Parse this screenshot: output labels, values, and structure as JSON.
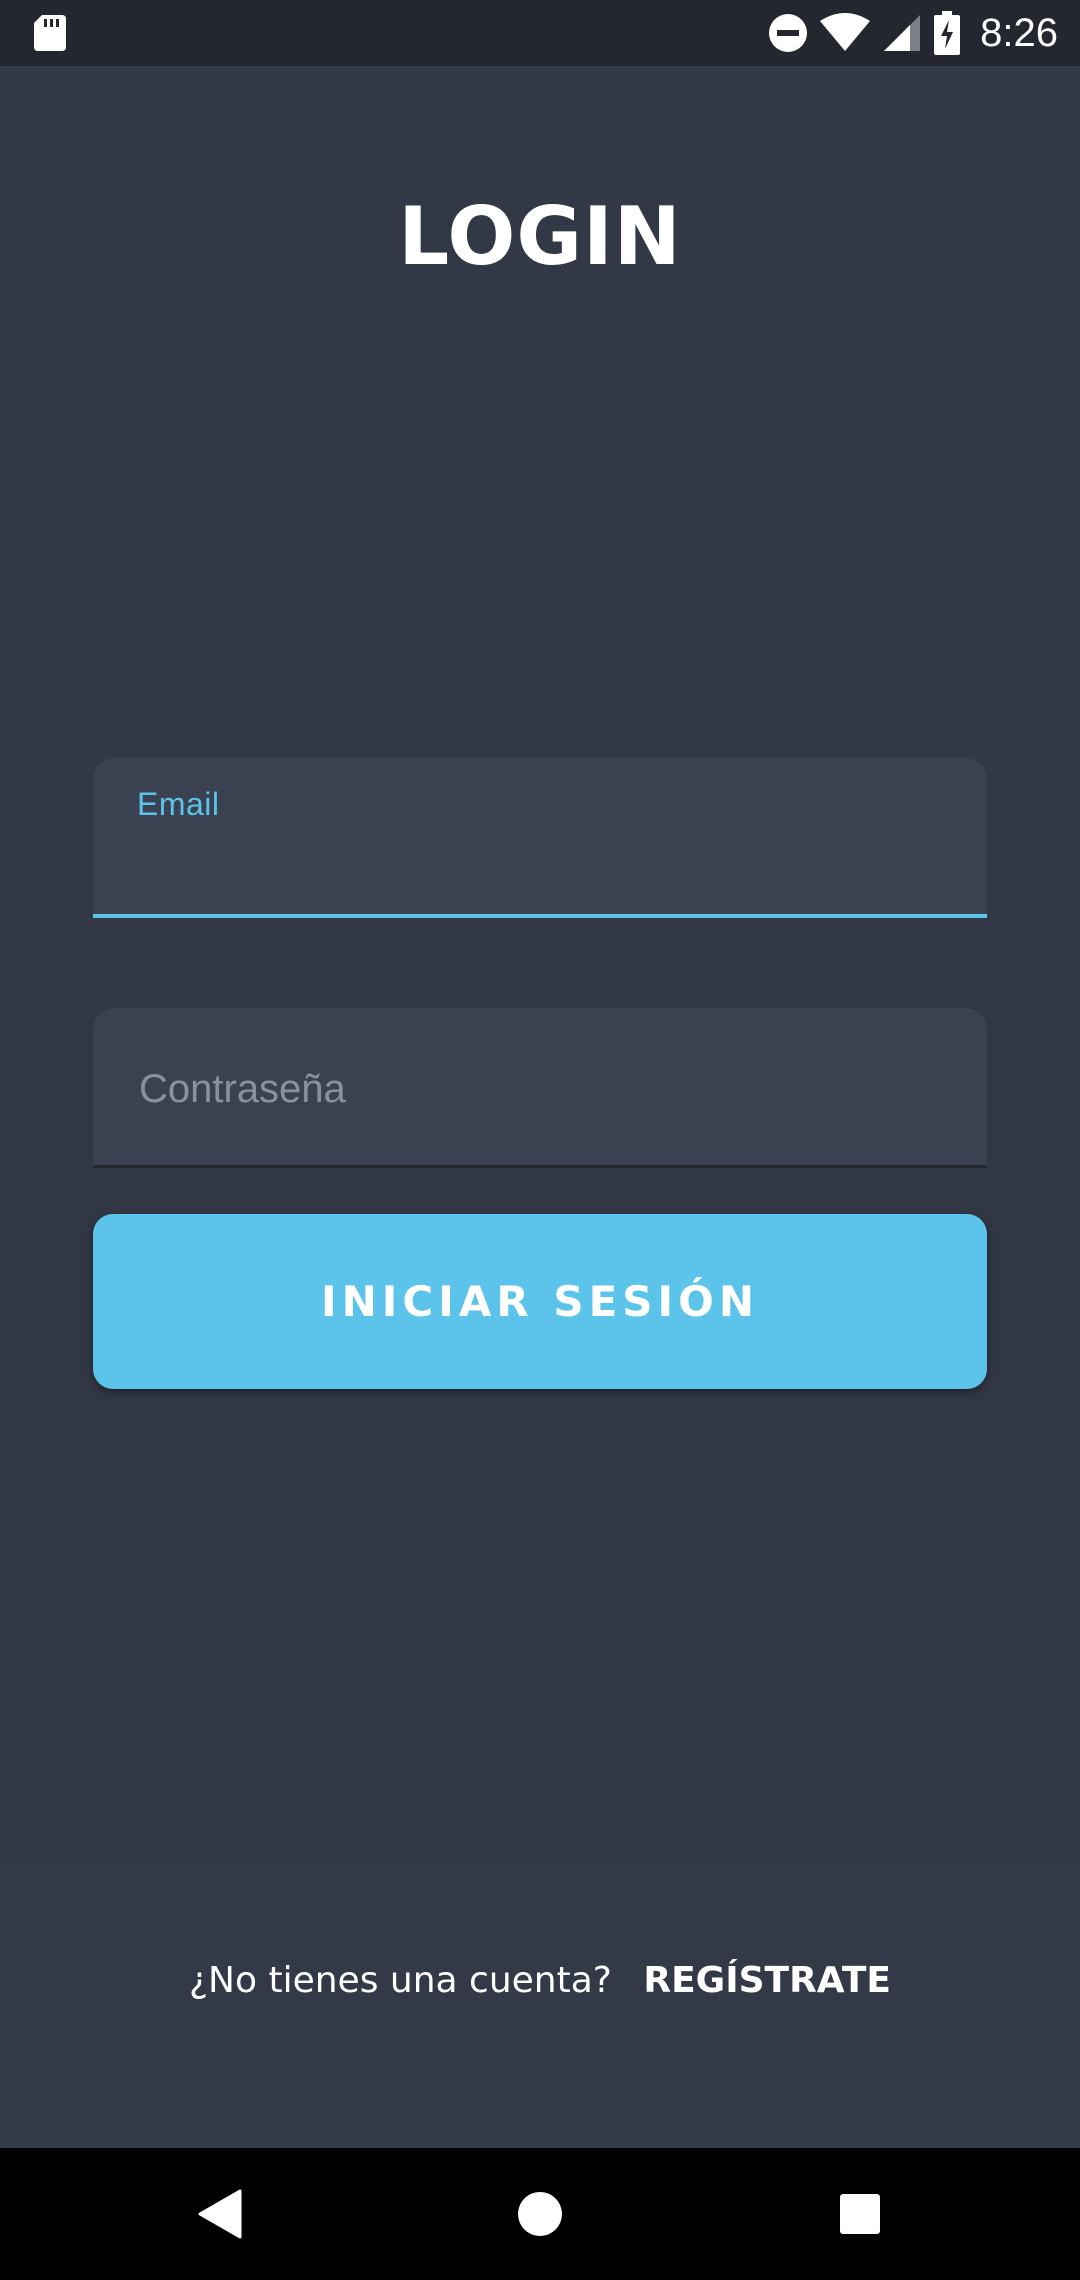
{
  "status_bar": {
    "time": "8:26",
    "icons": [
      "sd-card-icon",
      "do-not-disturb-icon",
      "wifi-icon",
      "cell-signal-icon",
      "battery-charging-icon"
    ]
  },
  "title": "LOGIN",
  "email_field": {
    "label": "Email",
    "value": ""
  },
  "password_field": {
    "placeholder": "Contraseña",
    "value": ""
  },
  "login_button": {
    "label": "INICIAR SESIÓN"
  },
  "register": {
    "question": "¿No tienes una cuenta?",
    "link_label": "REGÍSTRATE"
  },
  "nav_bar": {
    "icons": [
      "back-icon",
      "home-icon",
      "recents-icon"
    ]
  },
  "colors": {
    "background": "#323744",
    "field_background": "#3a4252",
    "accent": "#5cc4ea",
    "status_bar": "#24272f",
    "nav_bar": "#000000"
  }
}
